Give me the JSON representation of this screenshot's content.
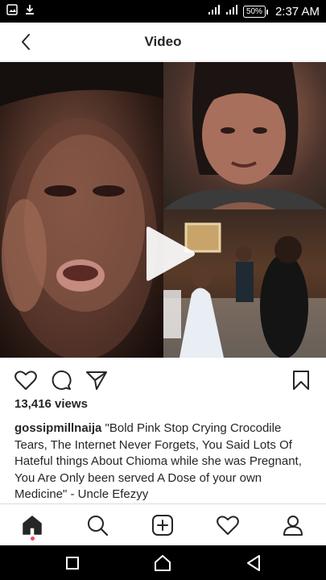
{
  "status_bar": {
    "time": "2:37 AM",
    "battery": "50%",
    "icons": [
      "image-icon",
      "download-icon",
      "signal-icon",
      "signal-icon",
      "battery-icon"
    ]
  },
  "header": {
    "title": "Video",
    "back_icon": "chevron-left-icon"
  },
  "post": {
    "media_icon": "play-icon",
    "actions": [
      "heart-icon",
      "comment-icon",
      "share-icon",
      "bookmark-icon"
    ],
    "views": "13,416 views",
    "caption": {
      "username": "gossipmillnaija",
      "text": "\"Bold Pink Stop Crying Crocodile Tears, The Internet Never Forgets, You Said Lots Of Hateful things About Chioma while she was Pregnant, You Are Only been served A Dose of your own Medicine\" - Uncle Efezyy"
    }
  },
  "bottom_nav": {
    "items": [
      "home-icon",
      "search-icon",
      "add-icon",
      "heart-icon",
      "profile-icon"
    ]
  },
  "system_nav": {
    "items": [
      "recents-icon",
      "home-icon",
      "back-icon"
    ]
  },
  "colors": {
    "text": "#262626",
    "divider": "#dbdbdb",
    "notification_dot": "#ed4956"
  }
}
